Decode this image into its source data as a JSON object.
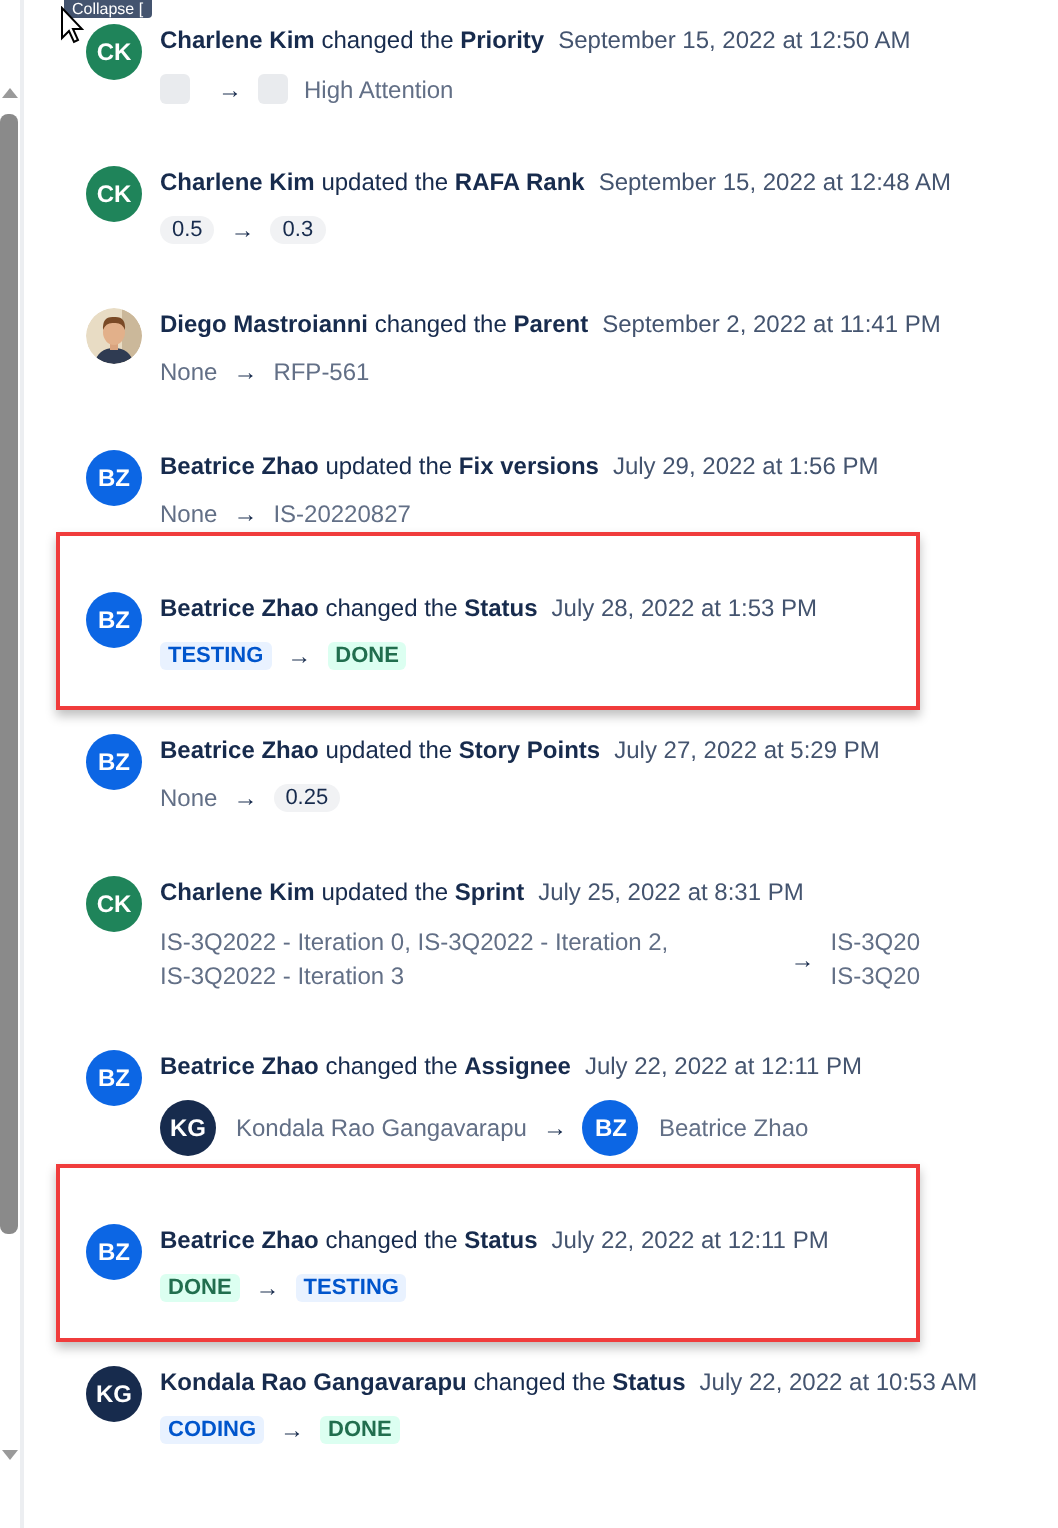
{
  "tooltip": {
    "text": "Collapse ["
  },
  "arrow": "→",
  "entries": [
    {
      "avatar": {
        "kind": "initials",
        "text": "CK",
        "color": "#1f845a"
      },
      "author": "Charlene Kim",
      "verb": "changed the",
      "field": "Priority",
      "date": "September 15, 2022 at 12:50 AM",
      "highlighted": false,
      "from": [
        {
          "kind": "priority"
        }
      ],
      "to": [
        {
          "kind": "priority",
          "text": "High Attention"
        }
      ]
    },
    {
      "avatar": {
        "kind": "initials",
        "text": "CK",
        "color": "#1f845a"
      },
      "author": "Charlene Kim",
      "verb": "updated the",
      "field": "RAFA Rank",
      "date": "September 15, 2022 at 12:48 AM",
      "highlighted": false,
      "from": [
        {
          "kind": "chip",
          "text": "0.5"
        }
      ],
      "to": [
        {
          "kind": "chip",
          "text": "0.3"
        }
      ]
    },
    {
      "avatar": {
        "kind": "picture"
      },
      "author": "Diego Mastroianni",
      "verb": "changed the",
      "field": "Parent",
      "date": "September 2, 2022 at 11:41 PM",
      "highlighted": false,
      "from": [
        {
          "kind": "text",
          "text": "None"
        }
      ],
      "to": [
        {
          "kind": "text",
          "text": "RFP-561"
        }
      ]
    },
    {
      "avatar": {
        "kind": "initials",
        "text": "BZ",
        "color": "#0c66e4"
      },
      "author": "Beatrice Zhao",
      "verb": "updated the",
      "field": "Fix versions",
      "date": "July 29, 2022 at 1:56 PM",
      "highlighted": false,
      "from": [
        {
          "kind": "text",
          "text": "None"
        }
      ],
      "to": [
        {
          "kind": "text",
          "text": "IS-20220827"
        }
      ]
    },
    {
      "avatar": {
        "kind": "initials",
        "text": "BZ",
        "color": "#0c66e4"
      },
      "author": "Beatrice Zhao",
      "verb": "changed the",
      "field": "Status",
      "date": "July 28, 2022 at 1:53 PM",
      "highlighted": true,
      "from": [
        {
          "kind": "status",
          "text": "TESTING",
          "color": "#0055cc"
        }
      ],
      "to": [
        {
          "kind": "status",
          "text": "DONE",
          "color": "#216e4e"
        }
      ]
    },
    {
      "avatar": {
        "kind": "initials",
        "text": "BZ",
        "color": "#0c66e4"
      },
      "author": "Beatrice Zhao",
      "verb": "updated the",
      "field": "Story Points",
      "date": "July 27, 2022 at 5:29 PM",
      "highlighted": false,
      "from": [
        {
          "kind": "text",
          "text": "None"
        }
      ],
      "to": [
        {
          "kind": "chip",
          "text": "0.25"
        }
      ]
    },
    {
      "avatar": {
        "kind": "initials",
        "text": "CK",
        "color": "#1f845a"
      },
      "author": "Charlene Kim",
      "verb": "updated the",
      "field": "Sprint",
      "date": "July 25, 2022 at 8:31 PM",
      "highlighted": false,
      "from": [
        {
          "kind": "text",
          "text": "IS-3Q2022 - Iteration 0, IS-3Q2022 - Iteration 2, IS-3Q2022 - Iteration 3"
        }
      ],
      "to": [
        {
          "kind": "text",
          "text": "IS-3Q20"
        },
        {
          "kind": "text",
          "text": "IS-3Q20"
        }
      ]
    },
    {
      "avatar": {
        "kind": "initials",
        "text": "BZ",
        "color": "#0c66e4"
      },
      "author": "Beatrice Zhao",
      "verb": "changed the",
      "field": "Assignee",
      "date": "July 22, 2022 at 12:11 PM",
      "highlighted": false,
      "from": [
        {
          "kind": "user",
          "initials": "KG",
          "color": "#172b4d",
          "text": "Kondala Rao Gangavarapu"
        }
      ],
      "to": [
        {
          "kind": "user",
          "initials": "BZ",
          "color": "#0c66e4",
          "text": "Beatrice Zhao"
        }
      ]
    },
    {
      "avatar": {
        "kind": "initials",
        "text": "BZ",
        "color": "#0c66e4"
      },
      "author": "Beatrice Zhao",
      "verb": "changed the",
      "field": "Status",
      "date": "July 22, 2022 at 12:11 PM",
      "highlighted": true,
      "from": [
        {
          "kind": "status",
          "text": "DONE",
          "color": "#216e4e"
        }
      ],
      "to": [
        {
          "kind": "status",
          "text": "TESTING",
          "color": "#0055cc"
        }
      ]
    },
    {
      "avatar": {
        "kind": "initials",
        "text": "KG",
        "color": "#172b4d"
      },
      "author": "Kondala Rao Gangavarapu",
      "verb": "changed the",
      "field": "Status",
      "date": "July 22, 2022 at 10:53 AM",
      "highlighted": false,
      "from": [
        {
          "kind": "status",
          "text": "CODING",
          "color": "#0055cc"
        }
      ],
      "to": [
        {
          "kind": "status",
          "text": "DONE",
          "color": "#216e4e"
        }
      ]
    }
  ]
}
